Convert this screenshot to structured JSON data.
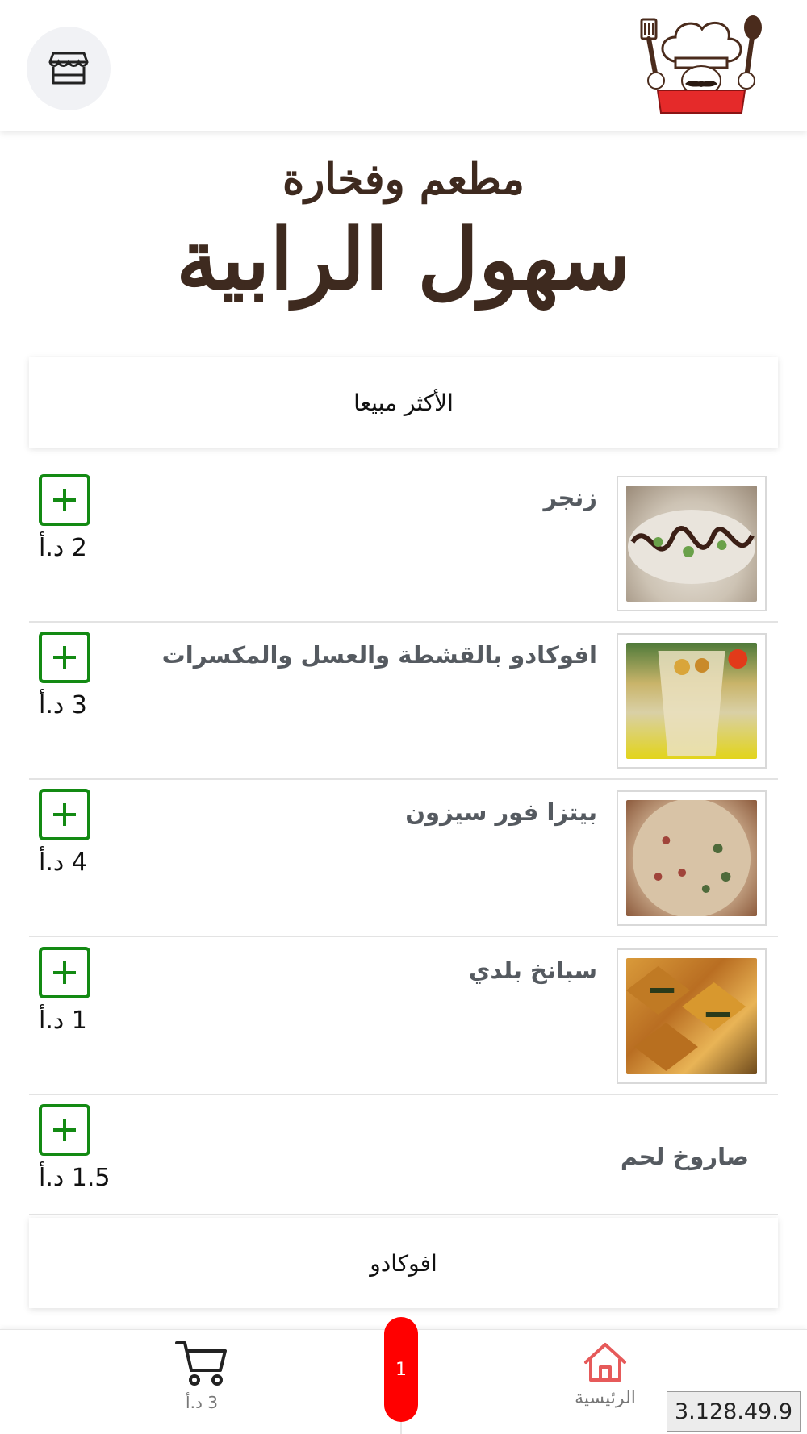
{
  "header": {
    "store_icon": "store-icon",
    "logo_text": "سهول الرابية"
  },
  "restaurant": {
    "subtitle": "مطعم وفخارة",
    "name": "سهول الرابية"
  },
  "sections": [
    {
      "title": "الأكثر مبيعا"
    },
    {
      "title": "افوكادو"
    }
  ],
  "items": [
    {
      "name": "زنجر",
      "price": "2 د.أ",
      "image": "zinger-wrap-photo",
      "add_icon": "plus-icon"
    },
    {
      "name": "افوكادو بالقشطة والعسل والمكسرات",
      "price": "3 د.أ",
      "image": "avocado-cup-photo",
      "add_icon": "plus-icon"
    },
    {
      "name": "بيتزا فور سيزون",
      "price": "4 د.أ",
      "image": "pizza-photo",
      "add_icon": "plus-icon"
    },
    {
      "name": "سبانخ بلدي",
      "price": "1 د.أ",
      "image": "spinach-pastry-photo",
      "add_icon": "plus-icon"
    },
    {
      "name": "صاروخ لحم",
      "price": "1.5 د.أ",
      "add_icon": "plus-icon"
    }
  ],
  "bottom_nav": {
    "cart_total": "3 د.أ",
    "cart_icon": "cart-icon",
    "cart_count": "1",
    "home_label": "الرئيسية",
    "home_icon": "home-icon"
  },
  "version": "3.128.49.9",
  "colors": {
    "accent_green": "#138a13",
    "badge_red": "#ff0000",
    "home_icon_red": "#e65a5a",
    "title_brown": "#3e2a1f"
  }
}
